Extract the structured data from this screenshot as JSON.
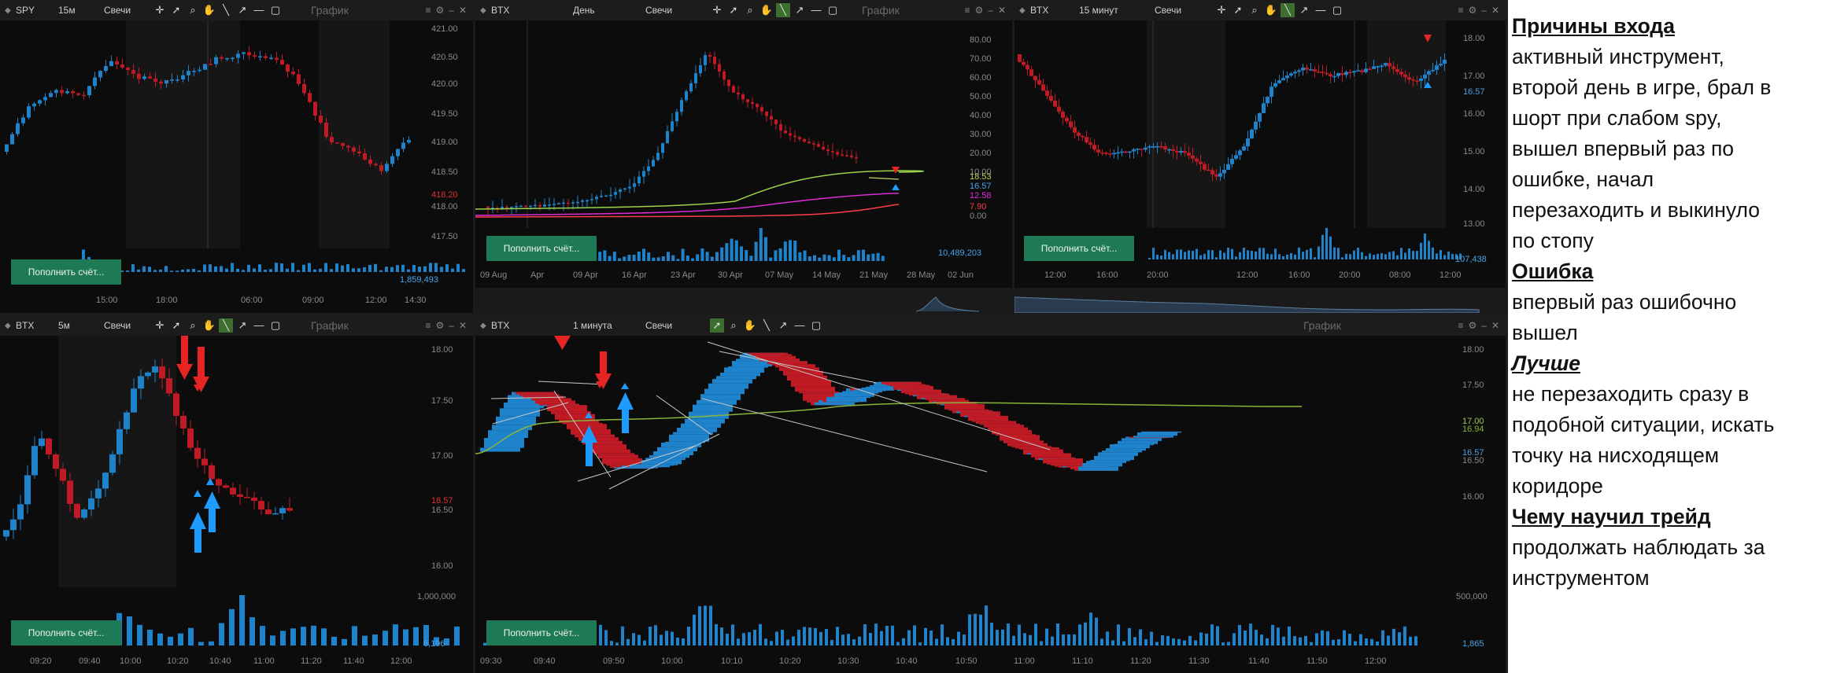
{
  "colors": {
    "up": "#1f83cc",
    "down": "#c01b25",
    "bg": "#0c0c0c",
    "toolbar": "#1c1c1c",
    "deposit": "#1d7a55",
    "ema_green": "#9bd34a",
    "ema_magenta": "#e02bd6",
    "ema_red": "#ff3b4d",
    "ema_yellow": "#c7d45b",
    "arrow_red": "#e62424",
    "arrow_blue": "#1e9bff"
  },
  "common": {
    "chart_type": "Свечи",
    "title": "График",
    "deposit_label": "Пополнить счёт..."
  },
  "panels": {
    "p1": {
      "symbol": "SPY",
      "timeframe": "15м",
      "yticks": [
        "421.00",
        "420.50",
        "420.00",
        "419.50",
        "419.00",
        "418.50",
        "418.00",
        "417.50"
      ],
      "price_label": "418.20",
      "vol_label": "1,859,493",
      "xticks": [
        "15:00",
        "18:00",
        "06:00",
        "09:00",
        "12:00",
        "14:30"
      ]
    },
    "p2": {
      "symbol": "BTX",
      "timeframe": "День",
      "yticks": [
        "80.00",
        "70.00",
        "60.00",
        "50.00",
        "40.00",
        "30.00",
        "20.00",
        "10.00",
        "0.00"
      ],
      "price_labels": [
        "18.53",
        "16.57",
        "12.58",
        "7.90"
      ],
      "vol_label": "10,489,203",
      "xticks": [
        "09 Aug",
        "Apr",
        "09 Apr",
        "16 Apr",
        "23 Apr",
        "30 Apr",
        "07 May",
        "14 May",
        "21 May",
        "28 May",
        "02 Jun"
      ]
    },
    "p3": {
      "symbol": "BTX",
      "timeframe": "15 минут",
      "yticks": [
        "18.00",
        "17.00",
        "16.00",
        "15.00",
        "14.00",
        "13.00"
      ],
      "price_label": "16.57",
      "vol_label": "107,438",
      "xticks": [
        "12:00",
        "16:00",
        "20:00",
        "12:00",
        "16:00",
        "20:00",
        "08:00",
        "12:00"
      ]
    },
    "p4": {
      "symbol": "BTX",
      "timeframe": "5м",
      "yticks": [
        "18.00",
        "17.50",
        "17.00",
        "16.50",
        "16.00"
      ],
      "price_label": "16.57",
      "vol_top": "1,000,000",
      "vol_label": "6,196",
      "xticks": [
        "09:20",
        "09:40",
        "10:00",
        "10:20",
        "10:40",
        "11:00",
        "11:20",
        "11:40",
        "12:00"
      ]
    },
    "p5": {
      "symbol": "BTX",
      "timeframe": "1 минута",
      "yticks": [
        "18.00",
        "17.50",
        "17.00",
        "16.50",
        "16.00"
      ],
      "price_labels": [
        "17.00",
        "16.94",
        "16.57"
      ],
      "vol_top": "500,000",
      "vol_label": "1,865",
      "xticks": [
        "09:30",
        "09:40",
        "09:50",
        "10:00",
        "10:10",
        "10:20",
        "10:30",
        "10:40",
        "10:50",
        "11:00",
        "11:10",
        "11:20",
        "11:30",
        "11:40",
        "11:50",
        "12:00"
      ]
    }
  },
  "notes": {
    "h1": "Причины входа",
    "t1": [
      "активный инструмент,",
      "второй день в игре, брал в",
      "шорт при слабом spy,",
      "вышел впервый раз по",
      "ошибке, начал",
      "перезаходить и выкинуло",
      "по стопу"
    ],
    "h2": "Ошибка",
    "t2": [
      "впервый раз ошибочно",
      "вышел"
    ],
    "h3": "Лучше",
    "t3": [
      "не перезаходить сразу в",
      "подобной ситуации, искать",
      "точку на нисходящем",
      "коридоре"
    ],
    "h4": "Чему научил трейд",
    "t4": [
      "продолжать наблюдать за",
      "инструментом"
    ]
  }
}
